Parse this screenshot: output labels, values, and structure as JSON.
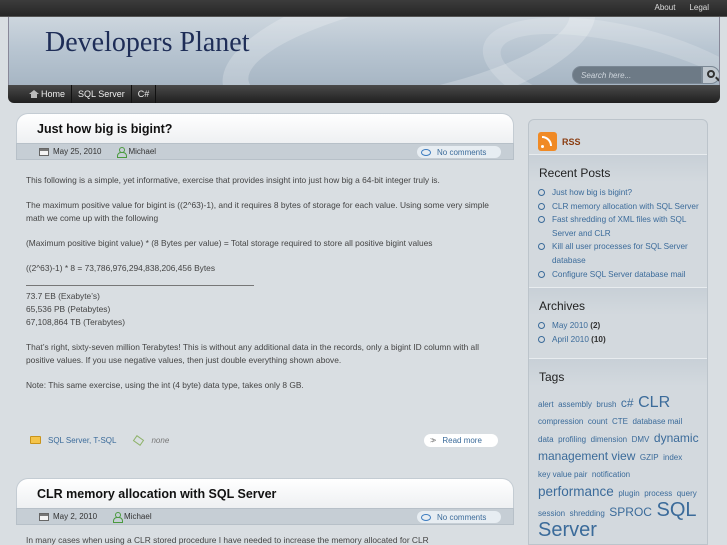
{
  "top_nav": {
    "about": "About",
    "legal": "Legal"
  },
  "site_title": "Developers Planet",
  "search": {
    "placeholder": "Search here..."
  },
  "nav": {
    "home": "Home",
    "sql_server": "SQL Server",
    "csharp": "C#"
  },
  "posts": [
    {
      "title": "Just how big is bigint?",
      "date": "May 25, 2010",
      "author": "Michael",
      "comments": "No comments",
      "paragraphs": [
        "This following is a simple, yet informative, exercise that provides insight into just how big a 64-bit integer truly is.",
        "The maximum positive value for bigint is ((2^63)-1), and it requires 8 bytes of storage for each value. Using some very simple math we come up with the following",
        "(Maximum positive bigint value) * (8 Bytes per value) = Total storage required to store all positive bigint values",
        "((2^63)-1) * 8 = 73,786,976,294,838,206,456 Bytes"
      ],
      "sizes": [
        "73.7 EB (Exabyte’s)",
        "65,536 PB (Petabytes)",
        "67,108,864 TB (Terabytes)"
      ],
      "paragraphs_after": [
        "That’s right, sixty-seven million Terabytes! This is without any additional data in the records, only a bigint ID column with all positive values. If you use negative values, then just double everything shown above.",
        "Note: This same exercise, using the int (4 byte) data type, takes only 8 GB."
      ],
      "categories": "SQL Server, T-SQL",
      "tags": "none",
      "read_more": "Read more"
    },
    {
      "title": "CLR memory allocation with SQL Server",
      "date": "May 2, 2010",
      "author": "Michael",
      "comments": "No comments",
      "excerpt": "In many cases when using a CLR stored procedure I have needed to increase the memory allocated for CLR"
    }
  ],
  "sidebar": {
    "rss": "RSS",
    "recent_posts_title": "Recent Posts",
    "recent_posts": [
      "Just how big is bigint?",
      "CLR memory allocation with SQL Server",
      "Fast shredding of XML files with SQL Server and CLR",
      "Kill all user processes for SQL Server database",
      "Configure SQL Server database mail"
    ],
    "archives_title": "Archives",
    "archives": [
      {
        "month": "May 2010",
        "count": "(2)"
      },
      {
        "month": "April 2010",
        "count": "(10)"
      }
    ],
    "tags_title": "Tags",
    "tags": [
      {
        "t": "alert",
        "s": 1
      },
      {
        "t": "assembly",
        "s": 1
      },
      {
        "t": "brush",
        "s": 1
      },
      {
        "t": "c#",
        "s": 3
      },
      {
        "t": "CLR",
        "s": 5
      },
      {
        "t": "compression",
        "s": 1
      },
      {
        "t": "count",
        "s": 1
      },
      {
        "t": "CTE",
        "s": 1
      },
      {
        "t": "database mail",
        "s": 1
      },
      {
        "t": "data",
        "s": 1
      },
      {
        "t": "profiling",
        "s": 1
      },
      {
        "t": "dimension",
        "s": 1
      },
      {
        "t": "DMV",
        "s": 1
      },
      {
        "t": "dynamic management view",
        "s": 3
      },
      {
        "t": "GZIP",
        "s": 1
      },
      {
        "t": "index",
        "s": 1
      },
      {
        "t": "key value pair",
        "s": 1
      },
      {
        "t": "notification",
        "s": 1
      },
      {
        "t": "performance",
        "s": 4
      },
      {
        "t": "plugin",
        "s": 1
      },
      {
        "t": "process",
        "s": 1
      },
      {
        "t": "query",
        "s": 1
      },
      {
        "t": "session",
        "s": 1
      },
      {
        "t": "shredding",
        "s": 1
      },
      {
        "t": "SPROC",
        "s": 3
      },
      {
        "t": "SQL Server",
        "s": 6
      }
    ]
  }
}
